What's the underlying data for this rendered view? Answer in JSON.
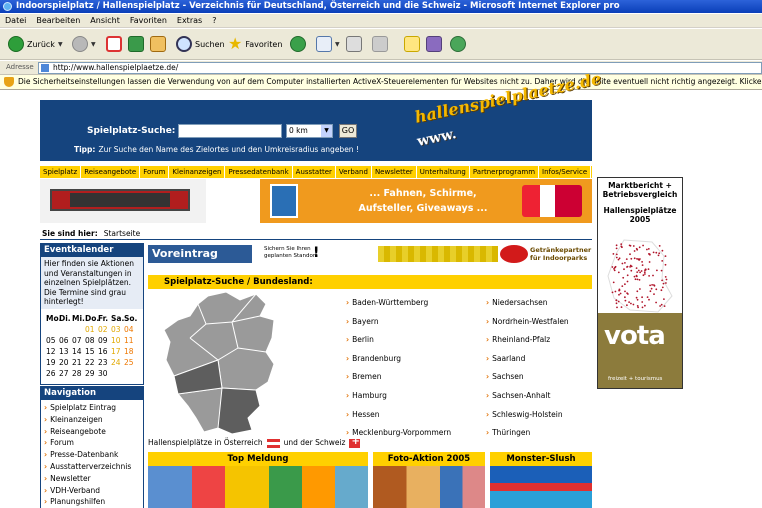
{
  "window": {
    "title": "Indoorspielplatz / Hallenspielplatz - Verzeichnis für Deutschland, Österreich und die Schweiz - Microsoft Internet Explorer pro"
  },
  "menu": [
    "Datei",
    "Bearbeiten",
    "Ansicht",
    "Favoriten",
    "Extras",
    "?"
  ],
  "toolbar": {
    "back": "Zurück",
    "search": "Suchen",
    "favorites": "Favoriten"
  },
  "address": {
    "label": "Adresse",
    "url": "http://www.hallenspielplaetze.de/"
  },
  "infobar": "Die Sicherheitseinstellungen lassen die Verwendung von auf dem Computer installierten ActiveX-Steuerelementen für Websites nicht zu. Daher wird die Seite eventuell nicht richtig angezeigt. Klicken Sie hier, um Optionen",
  "header": {
    "search_label": "Spielplatz-Suche:",
    "radius_value": "0 km",
    "go": "GO",
    "tip_label": "Tipp:",
    "tip": "Zur Suche den Name des Zielortes und den Umkreisradius angeben !",
    "logo_text": "hallenspielplaetze.de",
    "logo_www": "www."
  },
  "nav": [
    "Spielplatz",
    "Reiseangebote",
    "Forum",
    "Kleinanzeigen",
    "Pressedatenbank",
    "Ausstatter",
    "Verband",
    "Newsletter",
    "Unterhaltung",
    "Partnerprogramm",
    "Infos/Service"
  ],
  "banner": {
    "line1": "... Fahnen, Schirme,",
    "line2": "Aufsteller, Giveaways ..."
  },
  "breadcrumb": {
    "label": "Sie sind hier:",
    "current": "Startseite"
  },
  "eventkalender": {
    "title": "Eventkalender",
    "text": "Hier finden sie Aktionen und Veranstaltungen in einzelnen Spielplätzen. Die Termine sind grau hinterlegt!",
    "weekdays": [
      "Mo.",
      "Di.",
      "Mi.",
      "Do.",
      "Fr.",
      "Sa.",
      "So."
    ],
    "weeks": [
      [
        "",
        "",
        "",
        "01",
        "02",
        "03",
        "04"
      ],
      [
        "05",
        "06",
        "07",
        "08",
        "09",
        "10",
        "11"
      ],
      [
        "12",
        "13",
        "14",
        "15",
        "16",
        "17",
        "18"
      ],
      [
        "19",
        "20",
        "21",
        "22",
        "23",
        "24",
        "25"
      ],
      [
        "26",
        "27",
        "28",
        "29",
        "30",
        "",
        ""
      ]
    ]
  },
  "navigation": {
    "title": "Navigation",
    "items": [
      "Spielplatz Eintrag",
      "Kleinanzeigen",
      "Reiseangebote",
      "Forum",
      "Presse-Datenbank",
      "Ausstatterverzeichnis",
      "Newsletter",
      "VDH-Verband",
      "Planungshilfen"
    ]
  },
  "voreintrag": {
    "title": "Voreintrag",
    "sub1": "Sichern Sie Ihren",
    "sub2": "geplanten Standort",
    "partner1": "Getränkepartner",
    "partner2": "für Indoorparks"
  },
  "bundesland": {
    "title": "Spielplatz-Suche / Bundesland:",
    "col1": [
      "Baden-Württemberg",
      "Bayern",
      "Berlin",
      "Brandenburg",
      "Bremen",
      "Hamburg",
      "Hessen",
      "Mecklenburg-Vorpommern"
    ],
    "col2": [
      "Niedersachsen",
      "Nordrhein-Westfalen",
      "Rheinland-Pfalz",
      "Saarland",
      "Sachsen",
      "Sachsen-Anhalt",
      "Schleswig-Holstein",
      "Thüringen"
    ],
    "austria_text": "Hallenspielplätze in Österreich",
    "swiss_text": "und der Schweiz"
  },
  "teasers": [
    "Top Meldung",
    "Foto-Aktion 2005",
    "Monster-Slush"
  ],
  "ad": {
    "line1": "Marktbericht +",
    "line2": "Betriebsvergleich",
    "line3": "Hallenspielplätze",
    "line4": "2005",
    "brand": "vota",
    "tagline": "freizeit + tourismus"
  }
}
